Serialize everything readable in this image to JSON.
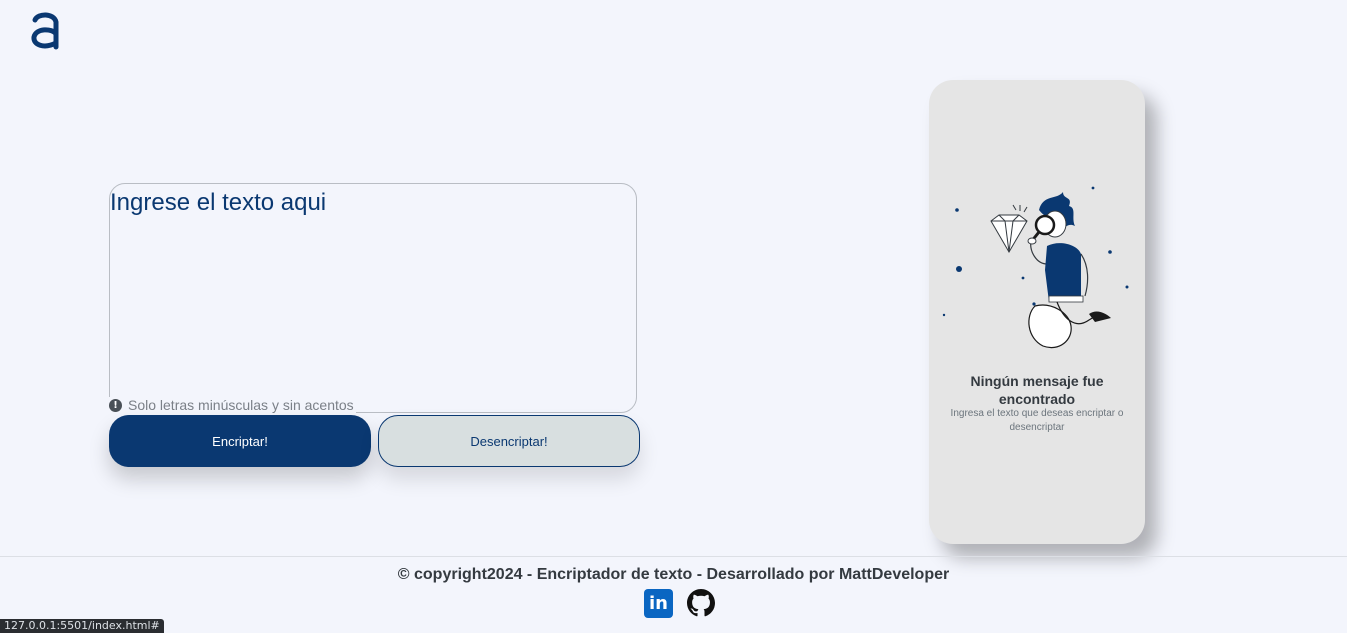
{
  "logo": {
    "icon": "alura-logo-icon",
    "color": "#0a3871"
  },
  "input": {
    "placeholder": "Ingrese el texto aqui"
  },
  "hint": {
    "icon": "exclamation-icon",
    "text": "Solo letras minúsculas y sin acentos"
  },
  "buttons": {
    "encrypt": "Encriptar!",
    "decrypt": "Desencriptar!"
  },
  "output_panel": {
    "title": "Ningún mensaje fue encontrado",
    "subtitle": "Ingresa el texto que deseas encriptar o desencriptar",
    "illustration": "person-with-magnifier-illustration"
  },
  "footer": {
    "text": "© copyright2024 - Encriptador de texto - Desarrollado por MattDeveloper",
    "linkedin_glyph": "in",
    "social": [
      "linkedin-icon",
      "github-icon"
    ]
  },
  "status_bar": {
    "url": "127.0.0.1:5501/index.html#"
  },
  "colors": {
    "primary": "#0a3871",
    "background": "#f3f5fc",
    "panel": "#e5e5e5"
  }
}
